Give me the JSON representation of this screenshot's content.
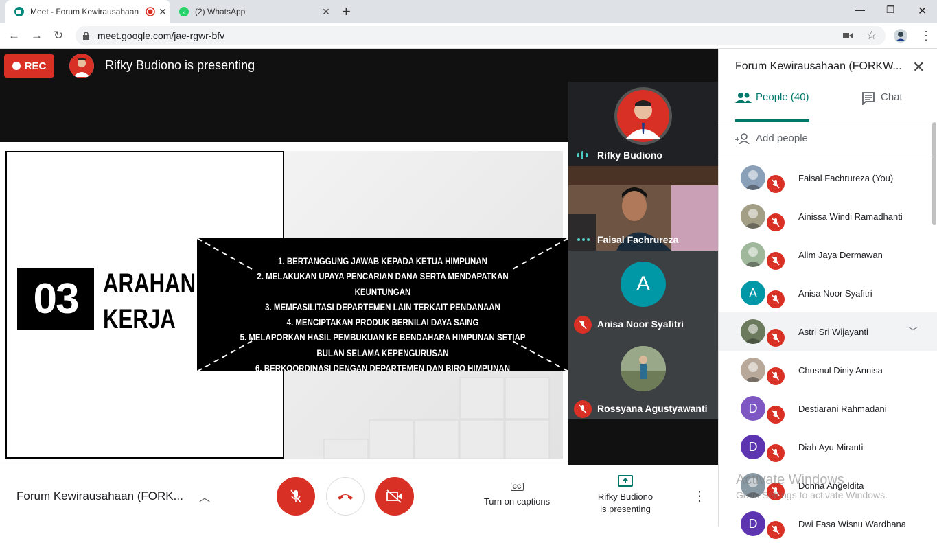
{
  "browser": {
    "tabs": [
      {
        "title": "Meet - Forum Kewirausahaan",
        "icon": "meet-icon",
        "recording": true
      },
      {
        "title": "(2) WhatsApp",
        "icon": "whatsapp-icon",
        "badge": "2"
      }
    ],
    "url": "meet.google.com/jae-rgwr-bfv"
  },
  "meet": {
    "rec_label": "REC",
    "presenting_text": "Rifky Budiono is presenting",
    "slide": {
      "number": "03",
      "title_line1": "ARAHAN",
      "title_line2": "KERJA",
      "items": [
        "1. BERTANGGUNG JAWAB KEPADA KETUA HIMPUNAN",
        "2. MELAKUKAN UPAYA PENCARIAN DANA SERTA MENDAPATKAN KEUNTUNGAN",
        "3. MEMFASILITASI DEPARTEMEN LAIN TERKAIT PENDANAAN",
        "4. MENCIPTAKAN PRODUK BERNILAI DAYA SAING",
        "5. MELAPORKAN HASIL PEMBUKUAN KE BENDAHARA HIMPUNAN SETIAP",
        "BULAN SELAMA KEPENGURUSAN",
        "6. BERKOORDINASI DENGAN DEPARTEMEN DAN BIRO HIMPUNAN"
      ]
    },
    "tiles": [
      {
        "name": "Rifky Budiono"
      },
      {
        "name": "Faisal Fachrureza"
      },
      {
        "name": "Anisa Noor Syafitri",
        "initial": "A"
      },
      {
        "name": "Rossyana Agustyawanti"
      }
    ],
    "bottom": {
      "meeting_name": "Forum Kewirausahaan (FORK...",
      "captions_icon": "CC",
      "captions_label": "Turn on captions",
      "present_line1": "Rifky Budiono",
      "present_line2": "is presenting"
    }
  },
  "panel": {
    "title": "Forum Kewirausahaan (FORKW...",
    "people_tab": "People (40)",
    "chat_tab": "Chat",
    "add_people": "Add people",
    "people": [
      {
        "name": "Faisal Fachrureza (You)",
        "initial": "",
        "color": "#8aa0b8"
      },
      {
        "name": "Ainissa Windi Ramadhanti",
        "initial": "",
        "color": "#a39e86"
      },
      {
        "name": "Alim Jaya Dermawan",
        "initial": "",
        "color": "#9fb79a"
      },
      {
        "name": "Anisa Noor Syafitri",
        "initial": "A",
        "color": "#0097a7"
      },
      {
        "name": "Astri Sri Wijayanti",
        "initial": "",
        "color": "#6b7a5c"
      },
      {
        "name": "Chusnul Diniy Annisa",
        "initial": "",
        "color": "#b8a89a"
      },
      {
        "name": "Destiarani Rahmadani",
        "initial": "D",
        "color": "#7e57c2"
      },
      {
        "name": "Diah Ayu Miranti",
        "initial": "D",
        "color": "#5e35b1"
      },
      {
        "name": "Donna Angeldita",
        "initial": "",
        "color": "#8a9aa5"
      },
      {
        "name": "Dwi Fasa Wisnu Wardhana",
        "initial": "D",
        "color": "#5e35b1"
      }
    ],
    "watermark_line1": "Activate Windows",
    "watermark_line2": "Go to Settings to activate Windows."
  }
}
